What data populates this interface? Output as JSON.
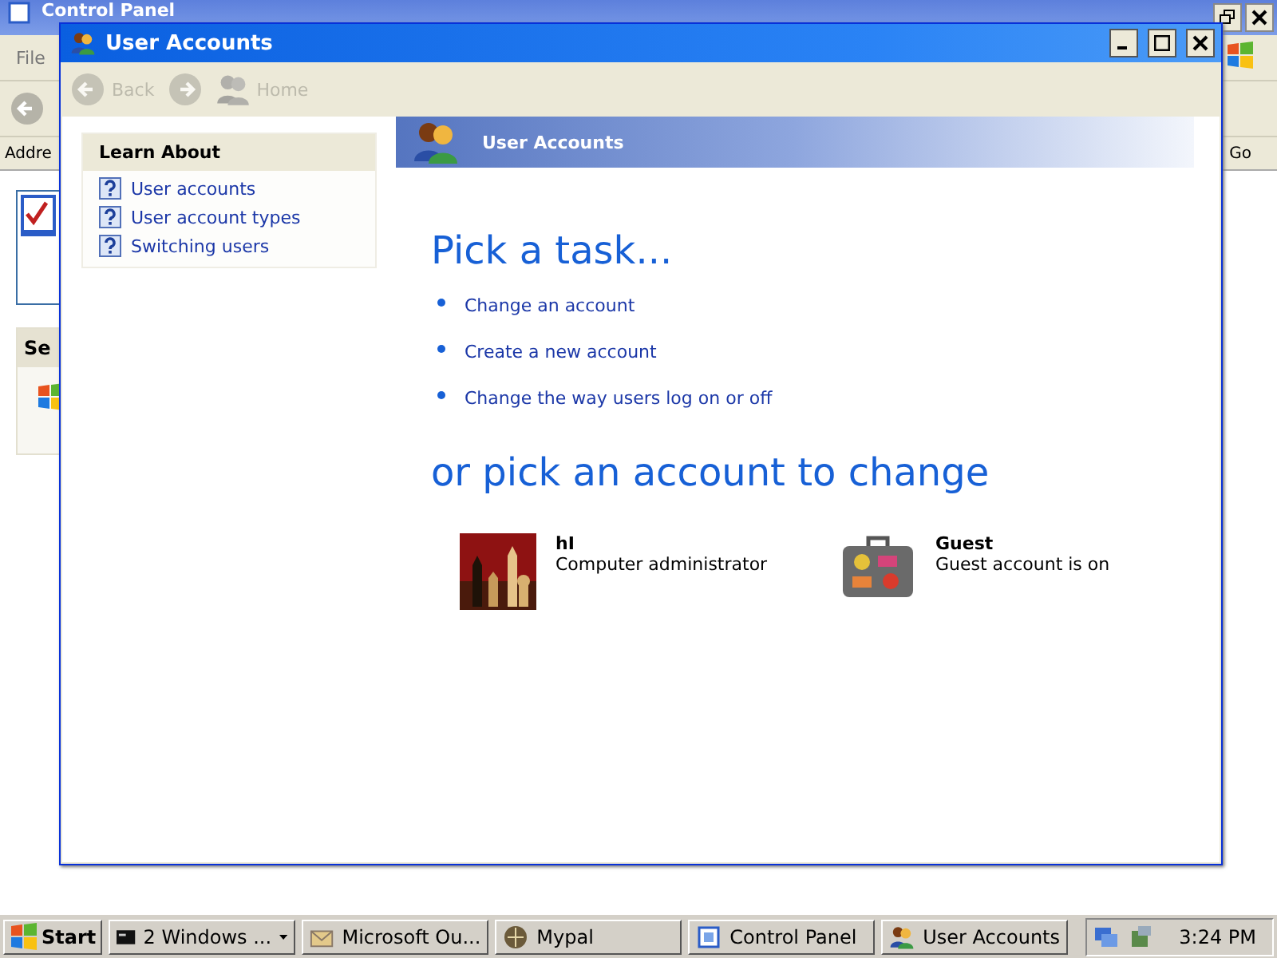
{
  "background_window": {
    "title": "Control Panel",
    "menu": [
      "File"
    ],
    "address_label": "Addre",
    "go_button": "Go",
    "panel_heading": "Se"
  },
  "window": {
    "title": "User Accounts",
    "toolbar": [
      {
        "label": "Back",
        "kind": "back",
        "disabled": true
      },
      {
        "kind": "forward",
        "disabled": true
      },
      {
        "label": "Home",
        "kind": "home",
        "disabled": true
      }
    ]
  },
  "sidebar": {
    "heading": "Learn About",
    "items": [
      "User accounts",
      "User account types",
      "Switching users"
    ]
  },
  "header": {
    "title": "User Accounts"
  },
  "tasks": {
    "heading": "Pick a task...",
    "items": [
      "Change an account",
      "Create a new account",
      "Change the way users log on or off"
    ]
  },
  "accounts": {
    "heading": "or pick an account to change",
    "items": [
      {
        "name": "hI",
        "description": "Computer administrator",
        "kind": "picture"
      },
      {
        "name": "Guest",
        "description": "Guest account is on",
        "kind": "suitcase"
      }
    ]
  },
  "taskbar": {
    "start": "Start",
    "buttons": [
      {
        "label": "2 Windows ...",
        "kind": "console",
        "group": true
      },
      {
        "label": "Microsoft Ou...",
        "kind": "outlook",
        "group": false
      },
      {
        "label": "Mypal",
        "kind": "browser",
        "group": false
      },
      {
        "label": "Control Panel",
        "kind": "panel",
        "group": false
      },
      {
        "label": "User Accounts",
        "kind": "users",
        "group": false
      }
    ],
    "clock": "3:24 PM"
  }
}
